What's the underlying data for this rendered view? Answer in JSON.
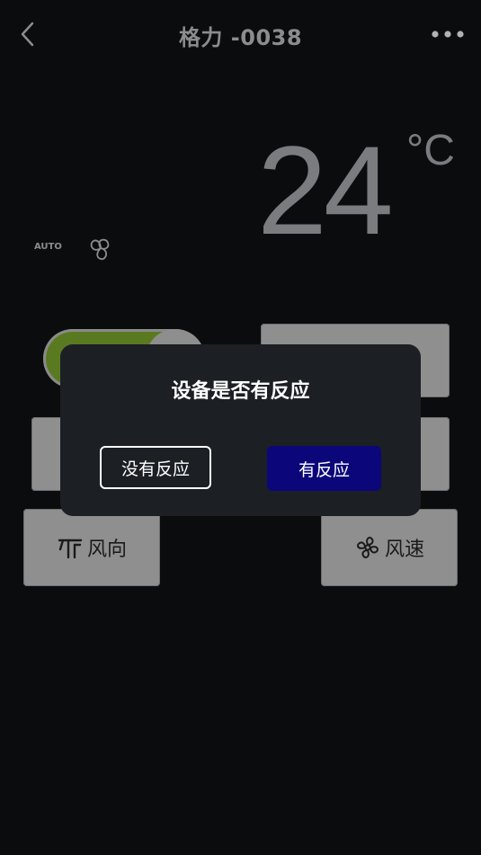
{
  "header": {
    "title": "格力 -0038"
  },
  "status": {
    "temperature": "24",
    "unit": "°C",
    "mode_label": "AUTO"
  },
  "controls": {
    "power_on": true,
    "wind_direction_label": "风向",
    "wind_speed_label": "风速"
  },
  "dialog": {
    "title": "设备是否有反应",
    "no_label": "没有反应",
    "yes_label": "有反应"
  },
  "colors": {
    "background": "#0b0c0e",
    "dialog_bg": "#1c1f24",
    "primary": "#0b067a",
    "toggle_on": "#5a7a22",
    "button_grey": "#8f8f8f"
  }
}
